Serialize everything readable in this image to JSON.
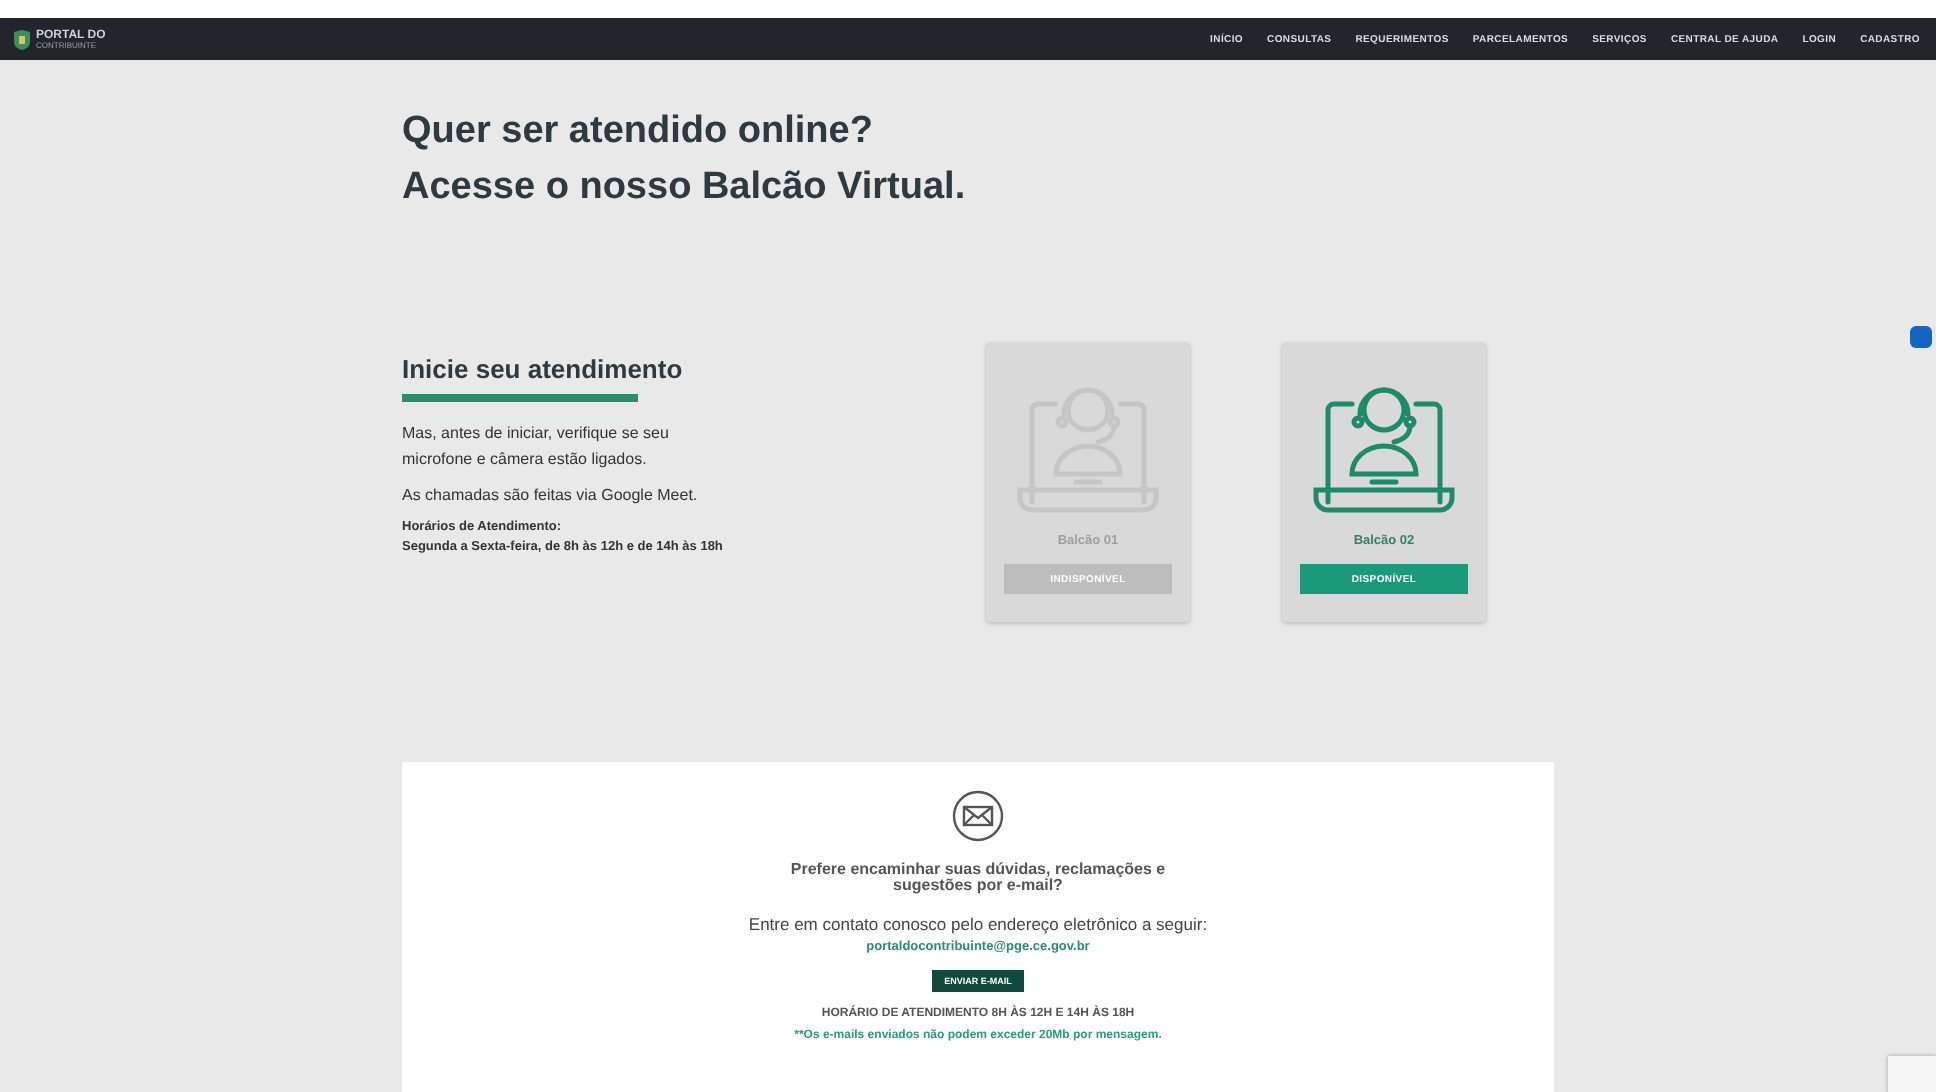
{
  "header": {
    "logo": {
      "line1": "PORTAL DO",
      "line2": "CONTRIBUINTE"
    },
    "nav": [
      {
        "label": "INÍCIO"
      },
      {
        "label": "CONSULTAS"
      },
      {
        "label": "REQUERIMENTOS"
      },
      {
        "label": "PARCELAMENTOS"
      },
      {
        "label": "SERVIÇOS"
      },
      {
        "label": "CENTRAL DE AJUDA"
      },
      {
        "label": "LOGIN"
      },
      {
        "label": "CADASTRO"
      }
    ]
  },
  "hero": {
    "line1": "Quer ser atendido online?",
    "line2": "Acesse o nosso Balcão Virtual."
  },
  "intro": {
    "title": "Inicie seu atendimento",
    "paragraphs": [
      "Mas, antes de iniciar, verifique se seu microfone e câmera estão ligados.",
      "As chamadas são feitas via Google Meet."
    ],
    "hours_label": "Horários de Atendimento:",
    "hours": "Segunda a Sexta-feira, de 8h às 12h e de 14h às 18h"
  },
  "desks": [
    {
      "name": "Balcão 01",
      "available": false,
      "button": "INDISPONÍVEL"
    },
    {
      "name": "Balcão 02",
      "available": true,
      "button": "DISPONÍVEL"
    }
  ],
  "email": {
    "question": "Prefere encaminhar suas dúvidas, reclamações e sugestões por e-mail?",
    "contact": "Entre em contato conosco pelo endereço eletrônico a seguir:",
    "address": "portaldocontribuinte@pge.ce.gov.br",
    "button": "ENVIAR E-MAIL",
    "hours": "HORÁRIO DE ATENDIMENTO 8H ÀS 12H E 14H ÀS 18H",
    "note": "**Os e-mails enviados não podem exceder 20Mb por mensagem."
  }
}
